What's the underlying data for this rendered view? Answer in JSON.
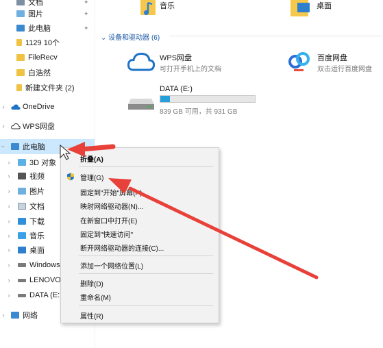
{
  "nav": {
    "quick_access": [
      {
        "label": "文档",
        "icon": "documents-icon",
        "pinned": true
      },
      {
        "label": "图片",
        "icon": "pictures-icon",
        "pinned": true
      },
      {
        "label": "此电脑",
        "icon": "this-pc-icon",
        "pinned": true
      },
      {
        "label": "1129 10个",
        "icon": "folder-icon",
        "pinned": false
      },
      {
        "label": "FileRecv",
        "icon": "folder-icon",
        "pinned": false
      },
      {
        "label": "白浩然",
        "icon": "folder-icon",
        "pinned": false
      },
      {
        "label": "新建文件夹 (2)",
        "icon": "folder-icon",
        "pinned": false
      }
    ],
    "onedrive": "OneDrive",
    "wps_cloud": "WPS网盘",
    "this_pc": "此电脑",
    "this_pc_children": [
      {
        "label": "3D 对象",
        "icon": "3d-objects-icon"
      },
      {
        "label": "视频",
        "icon": "videos-icon"
      },
      {
        "label": "图片",
        "icon": "pictures-icon"
      },
      {
        "label": "文档",
        "icon": "documents-icon"
      },
      {
        "label": "下载",
        "icon": "downloads-icon"
      },
      {
        "label": "音乐",
        "icon": "music-icon"
      },
      {
        "label": "桌面",
        "icon": "desktop-icon"
      },
      {
        "label": "Windows",
        "icon": "windows-drive-icon"
      },
      {
        "label": "LENOVO",
        "icon": "drive-icon"
      },
      {
        "label": "DATA (E:",
        "icon": "drive-icon"
      }
    ],
    "network": "网络"
  },
  "content": {
    "folders": [
      {
        "label": "音乐",
        "icon": "music-folder-icon"
      },
      {
        "label": "桌面",
        "icon": "desktop-folder-icon"
      }
    ],
    "group_header": "设备和驱动器 (6)",
    "devices": [
      {
        "name": "WPS网盘",
        "sub": "可打开手机上的文档",
        "icon": "wps-cloud-icon"
      },
      {
        "name": "百度网盘",
        "sub": "双击运行百度网盘",
        "icon": "baidu-netdisk-icon"
      },
      {
        "name": "DATA (E:)",
        "sub": "839 GB 可用，共 931 GB",
        "icon": "hard-drive-icon",
        "used_fraction": 0.099
      }
    ]
  },
  "context_menu": {
    "items": [
      {
        "label": "折叠(A)",
        "bold": true
      },
      {
        "label": "管理(G)",
        "bold": false,
        "icon": "uac-shield-icon"
      },
      {
        "label": "固定到\"开始\"屏幕(P)",
        "bold": false
      },
      {
        "label": "映射网络驱动器(N)...",
        "bold": false
      },
      {
        "label": "在新窗口中打开(E)",
        "bold": false
      },
      {
        "label": "固定到\"快速访问\"",
        "bold": false
      },
      {
        "label": "断开网络驱动器的连接(C)...",
        "bold": false
      },
      {
        "label": "添加一个网络位置(L)",
        "bold": false
      },
      {
        "label": "删除(D)",
        "bold": false
      },
      {
        "label": "重命名(M)",
        "bold": false
      },
      {
        "label": "属性(R)",
        "bold": false
      }
    ]
  },
  "colors": {
    "selection": "#cce8ff",
    "accent": "#26a0da",
    "annotation_arrow": "#e8413a",
    "group_header": "#1e5aa8"
  }
}
